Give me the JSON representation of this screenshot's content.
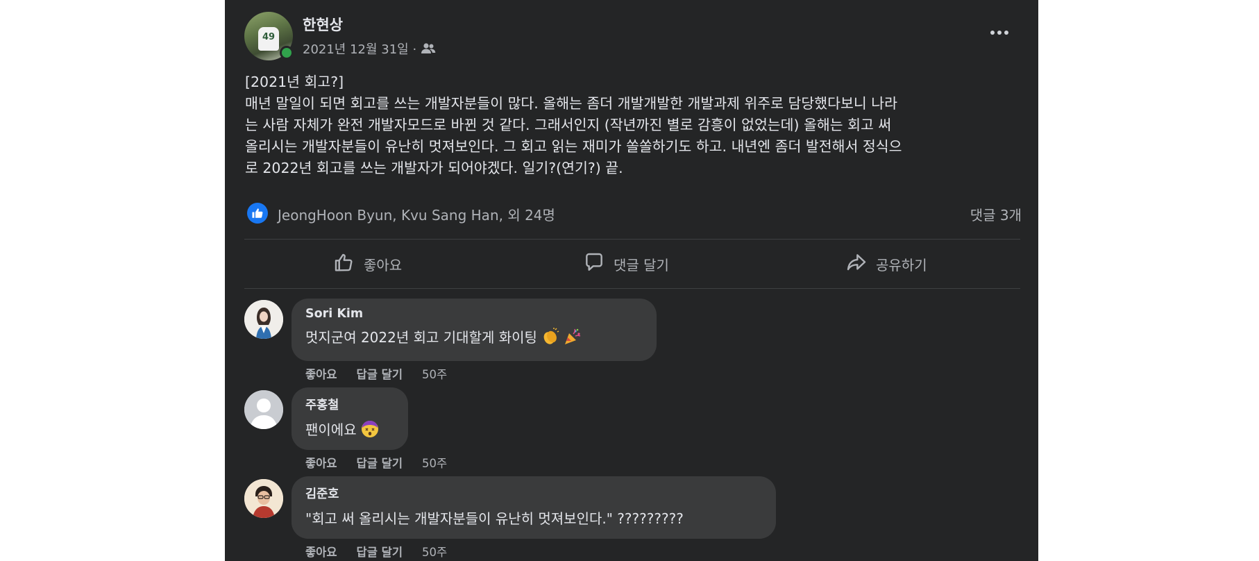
{
  "post": {
    "author": "한현상",
    "date": "2021년 12월 31일 ·",
    "audience_icon": "friends-icon",
    "more_icon": "more-horizontal-icon",
    "body_lines": [
      "[2021년 회고?]",
      "매년 말일이 되면 회고를 쓰는 개발자분들이 많다. 올해는 좀더 개발개발한 개발과제 위주로 담당했다보니 나라",
      "는 사람 자체가 완전 개발자모드로 바뀐 것 같다. 그래서인지 (작년까진 별로 감흥이 없었는데) 올해는 회고 써",
      "올리시는 개발자분들이 유난히 멋져보인다. 그 회고 읽는 재미가 쏠쏠하기도 하고. 내년엔 좀더 발전해서 정식으",
      "로 2022년 회고를 쓰는 개발자가 되어야겠다. 일기?(연기?) 끝."
    ],
    "reactors": "JeongHoon Byun, Kvu Sang Han, 외 24명",
    "comment_count": "댓글 3개",
    "accent_color": "#1877f2"
  },
  "actions": {
    "like": "좋아요",
    "comment": "댓글 달기",
    "share": "공유하기"
  },
  "comments": [
    {
      "name": "Sori Kim",
      "text": "멋지군여 2022년 회고 기대할게 화이팅",
      "emojis": [
        "clapping-hands-emoji",
        "party-popper-emoji"
      ],
      "like": "좋아요",
      "reply": "답글 달기",
      "time": "50주"
    },
    {
      "name": "주홍철",
      "text": "팬이에요",
      "emojis": [
        "dizzy-face-emoji"
      ],
      "like": "좋아요",
      "reply": "답글 달기",
      "time": "50주"
    },
    {
      "name": "김준호",
      "text": "\"회고 써 올리시는 개발자분들이 유난히 멋져보인다.\" ?????????",
      "emojis": [],
      "like": "좋아요",
      "reply": "답글 달기",
      "time": "50주"
    }
  ]
}
